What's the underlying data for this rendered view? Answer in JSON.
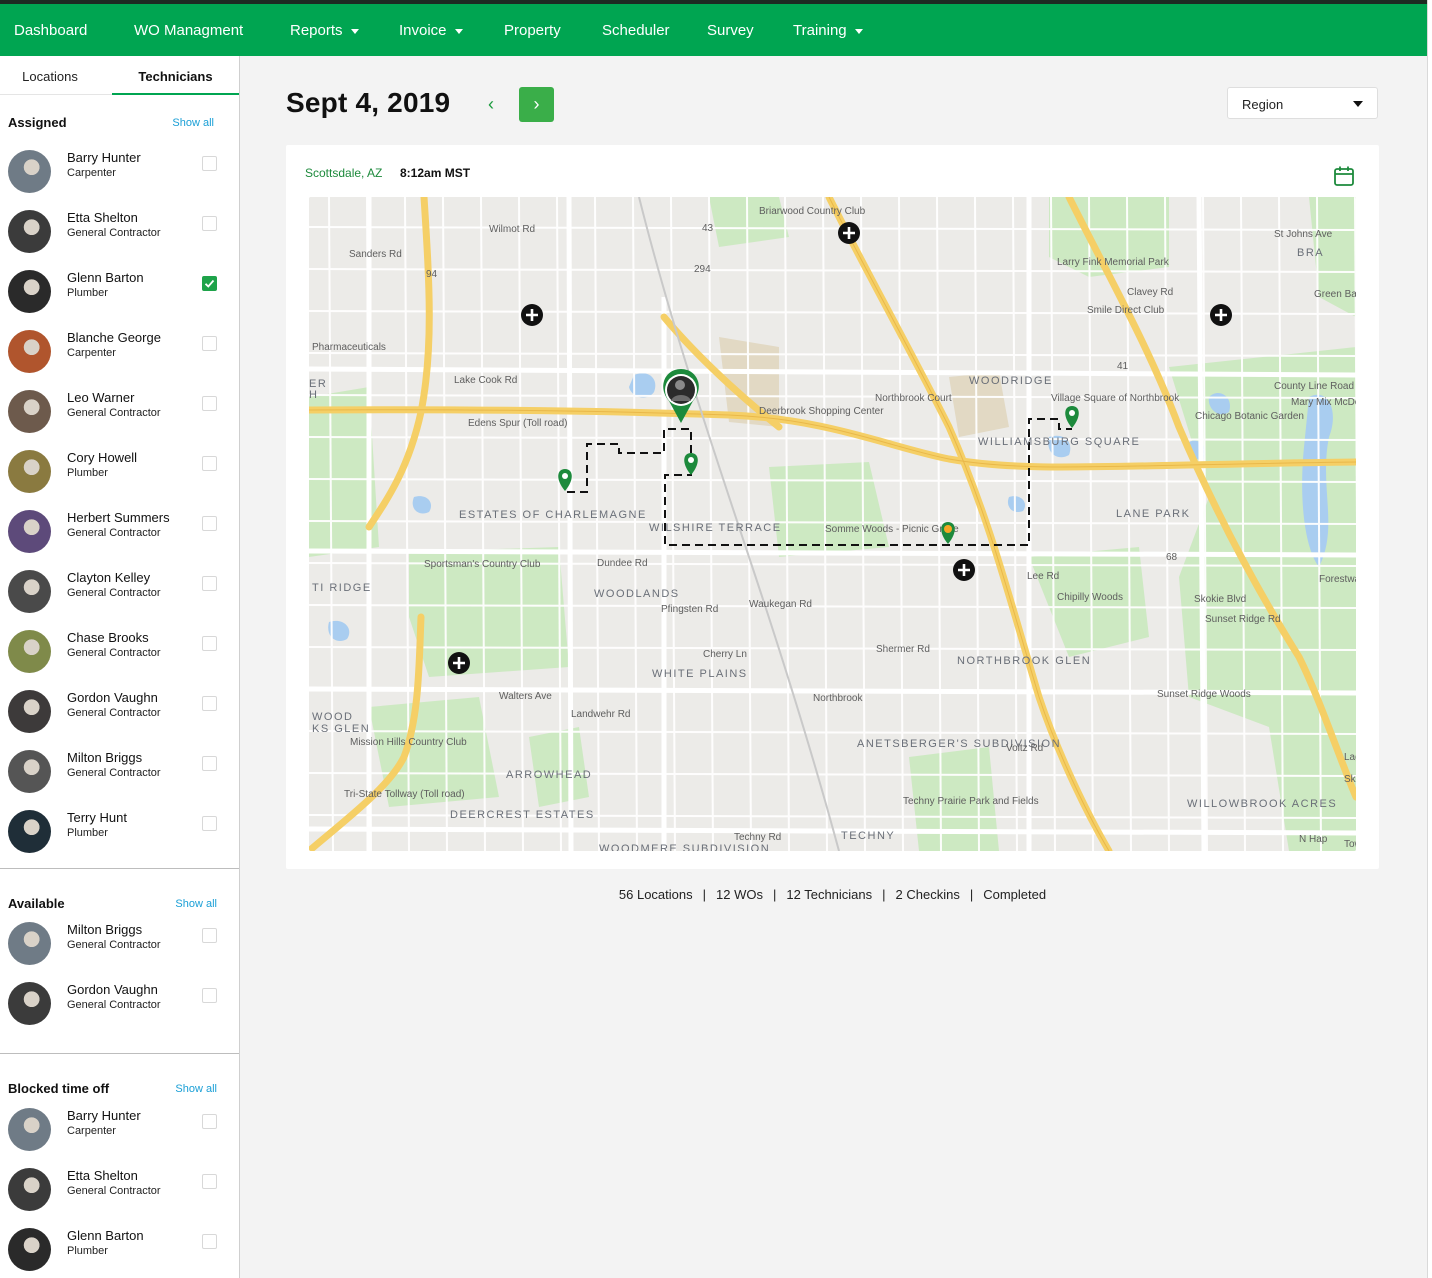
{
  "nav": {
    "items": [
      {
        "label": "Dashboard",
        "dropdown": false
      },
      {
        "label": "WO Managment",
        "dropdown": false
      },
      {
        "label": "Reports",
        "dropdown": true
      },
      {
        "label": "Invoice",
        "dropdown": true
      },
      {
        "label": "Property",
        "dropdown": false
      },
      {
        "label": "Scheduler",
        "dropdown": false
      },
      {
        "label": "Survey",
        "dropdown": false
      },
      {
        "label": "Training",
        "dropdown": true
      }
    ],
    "color": "#00a551"
  },
  "sidebar": {
    "tabs": [
      {
        "label": "Locations",
        "active": false
      },
      {
        "label": "Technicians",
        "active": true
      }
    ],
    "assigned": {
      "title": "Assigned",
      "show_all": "Show all",
      "technicians": [
        {
          "name": "Barry Hunter",
          "role": "Carpenter",
          "checked": false
        },
        {
          "name": "Etta Shelton",
          "role": "General Contractor",
          "checked": false
        },
        {
          "name": "Glenn Barton",
          "role": "Plumber",
          "checked": true
        },
        {
          "name": "Blanche George",
          "role": "Carpenter",
          "checked": false
        },
        {
          "name": "Leo Warner",
          "role": "General Contractor",
          "checked": false
        },
        {
          "name": "Cory Howell",
          "role": "Plumber",
          "checked": false
        },
        {
          "name": "Herbert Summers",
          "role": "General Contractor",
          "checked": false
        },
        {
          "name": "Clayton Kelley",
          "role": "General Contractor",
          "checked": false
        },
        {
          "name": "Chase Brooks",
          "role": "General Contractor",
          "checked": false
        },
        {
          "name": "Gordon Vaughn",
          "role": "General Contractor",
          "checked": false
        },
        {
          "name": "Milton Briggs",
          "role": "General Contractor",
          "checked": false
        },
        {
          "name": "Terry Hunt",
          "role": "Plumber",
          "checked": false
        }
      ]
    },
    "available": {
      "title": "Available",
      "show_all": "Show all",
      "technicians": [
        {
          "name": "Milton Briggs",
          "role": "General Contractor",
          "checked": false
        },
        {
          "name": "Gordon Vaughn",
          "role": "General Contractor",
          "checked": false
        }
      ]
    },
    "blocked": {
      "title": "Blocked time off",
      "show_all": "Show all",
      "technicians": [
        {
          "name": "Barry Hunter",
          "role": "Carpenter",
          "checked": false
        },
        {
          "name": "Etta Shelton",
          "role": "General Contractor",
          "checked": false
        },
        {
          "name": "Glenn Barton",
          "role": "Plumber",
          "checked": false
        }
      ]
    }
  },
  "main": {
    "date": "Sept 4, 2019",
    "prev_icon": "chevron-left-icon",
    "next_icon": "chevron-right-icon",
    "region_select": {
      "value": "Region"
    },
    "card": {
      "location": "Scottsdale, AZ",
      "time": "8:12am MST",
      "calendar_icon": "calendar-icon"
    },
    "map": {
      "labels": [
        "Briarwood Country Club",
        "Larry Fink Memorial Park",
        "Smile Direct Club",
        "Clavey Rd",
        "BRA",
        "Pharmaceuticals",
        "Lake Cook Rd",
        "Northbrook Court",
        "WOODRIDGE",
        "Village Square of Northbrook",
        "Deerbrook Shopping Center",
        "Edens Spur (Toll road)",
        "WILLIAMSBURG SQUARE",
        "Chicago Botanic Garden",
        "Mary Mix McDonald Woods",
        "ESTATES OF CHARLEMAGNE",
        "WILSHIRE TERRACE",
        "Somme Woods - Picnic Grove",
        "LANE PARK",
        "Sportsman's Country Club",
        "Dundee Rd",
        "WOODLANDS",
        "TI RIDGE",
        "Chipilly Woods",
        "Cherry Ln",
        "WHITE PLAINS",
        "NORTHBROOK GLEN",
        "Northbrook",
        "Walters Ave",
        "Sunset Ridge Woods",
        "Mission Hills Country Club",
        "ANETSBERGER'S SUBDIVISION",
        "ARROWHEAD",
        "Techny Prairie Park and Fields",
        "DEERCREST ESTATES",
        "WILLOWBROOK ACRES",
        "TECHNY",
        "WOODMERE SUBDIVISION",
        "Techny Rd",
        "Tri-State Tollway (Toll road)",
        "County Line Road",
        "Voltz Rd",
        "Shermer Rd",
        "Pfingsten Rd",
        "Landwehr Rd",
        "Sanders Rd",
        "Waukegan Rd",
        "Lee Rd",
        "Skokie Blvd",
        "Sunset Ridge Rd",
        "Wilmot Rd",
        "WOOD",
        "KS GLEN",
        "ER",
        "H",
        "Sk",
        "Lag",
        "Towe",
        "St Johns Ave",
        "Green Bay Rd",
        "Forestway Dr",
        "N Hap",
        "43",
        "294",
        "94",
        "41",
        "68"
      ],
      "marker_icons": [
        "add-circle-icon",
        "location-pin-icon",
        "technician-pin-icon"
      ]
    }
  },
  "stats": {
    "locations": "56 Locations",
    "wos": "12 WOs",
    "technicians": "12 Technicians",
    "checkins": "2 Checkins",
    "completed": "Completed",
    "separator": "|"
  }
}
